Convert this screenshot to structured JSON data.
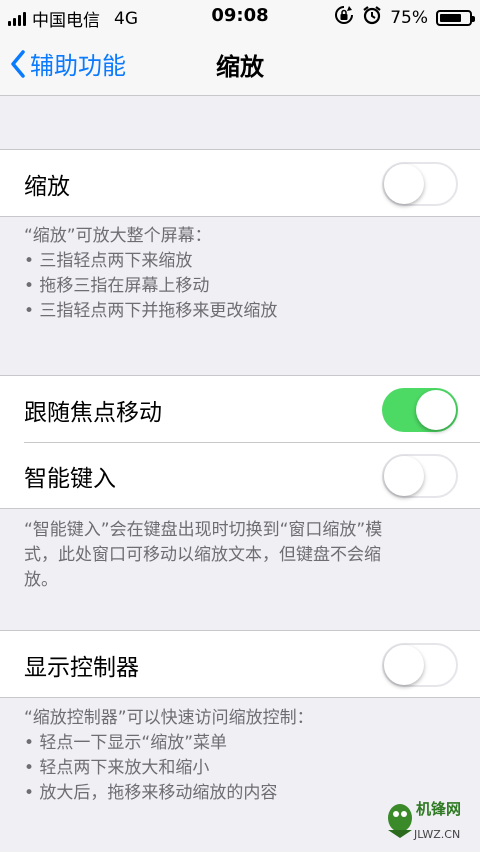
{
  "status": {
    "carrier": "中国电信",
    "network": "4G",
    "time": "09:08",
    "battery_pct": "75%",
    "battery_level": 0.75
  },
  "nav": {
    "back": "辅助功能",
    "title": "缩放"
  },
  "zoom": {
    "label": "缩放",
    "on": false,
    "footer": [
      "“缩放”可放大整个屏幕：",
      "• 三指轻点两下来缩放",
      "• 拖移三指在屏幕上移动",
      "• 三指轻点两下并拖移来更改缩放"
    ]
  },
  "follow_focus": {
    "label": "跟随焦点移动",
    "on": true
  },
  "smart_typing": {
    "label": "智能键入",
    "on": false,
    "footer": [
      "“智能键入”会在键盘出现时切换到“窗口缩放”模",
      "式，此处窗口可移动以缩放文本，但键盘不会缩",
      "放。"
    ]
  },
  "controller": {
    "label": "显示控制器",
    "on": false,
    "footer": [
      "“缩放控制器”可以快速访问缩放控制：",
      "• 轻点一下显示“缩放”菜单",
      "• 轻点两下来放大和缩小",
      "• 放大后，拖移来移动缩放的内容"
    ]
  },
  "watermark": {
    "text": "JLWZ.CN",
    "logo": "机锋网"
  },
  "colors": {
    "accent": "#0a7aff",
    "switch_on": "#4cd964",
    "background": "#efeff4"
  }
}
